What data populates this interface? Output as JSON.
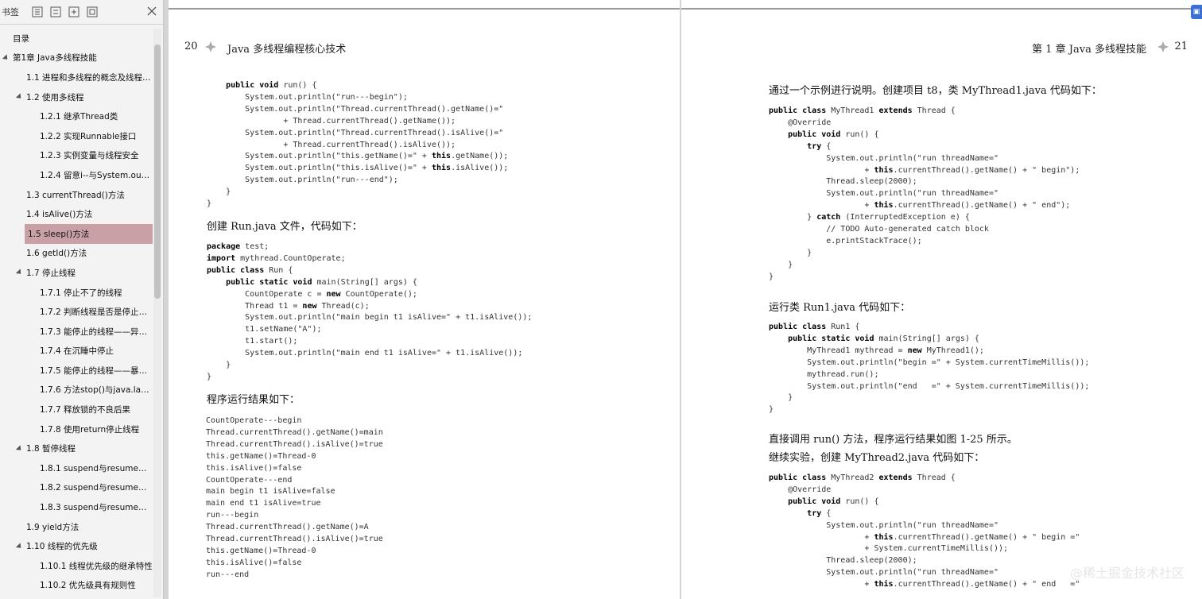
{
  "sidebar": {
    "header_title": "书签",
    "items": [
      {
        "label": "目录",
        "level": 0,
        "expand": false
      },
      {
        "label": "第1章 Java多线程技能",
        "level": 0,
        "expand": true
      },
      {
        "label": "1.1 进程和多线程的概念及线程的...",
        "level": 1,
        "expand": false
      },
      {
        "label": "1.2 使用多线程",
        "level": 1,
        "expand": true
      },
      {
        "label": "1.2.1 继承Thread类",
        "level": 2,
        "expand": false
      },
      {
        "label": "1.2.2 实现Runnable接口",
        "level": 2,
        "expand": false
      },
      {
        "label": "1.2.3 实例变量与线程安全",
        "level": 2,
        "expand": false
      },
      {
        "label": "1.2.4 留意i--与System.out.pr...",
        "level": 2,
        "expand": false
      },
      {
        "label": "1.3 currentThread()方法",
        "level": 1,
        "expand": false
      },
      {
        "label": "1.4 isAlive()方法",
        "level": 1,
        "expand": false
      },
      {
        "label": "1.5 sleep()方法",
        "level": 1,
        "expand": false,
        "active": true
      },
      {
        "label": "1.6 getId()方法",
        "level": 1,
        "expand": false
      },
      {
        "label": "1.7 停止线程",
        "level": 1,
        "expand": true
      },
      {
        "label": "1.7.1 停止不了的线程",
        "level": 2,
        "expand": false
      },
      {
        "label": "1.7.2 判断线程是否是停止状态",
        "level": 2,
        "expand": false
      },
      {
        "label": "1.7.3 能停止的线程——异常法",
        "level": 2,
        "expand": false
      },
      {
        "label": "1.7.4 在沉睡中停止",
        "level": 2,
        "expand": false
      },
      {
        "label": "1.7.5 能停止的线程——暴力...",
        "level": 2,
        "expand": false
      },
      {
        "label": "1.7.6 方法stop()与java.lang....",
        "level": 2,
        "expand": false
      },
      {
        "label": "1.7.7 释放锁的不良后果",
        "level": 2,
        "expand": false
      },
      {
        "label": "1.7.8 使用return停止线程",
        "level": 2,
        "expand": false
      },
      {
        "label": "1.8 暂停线程",
        "level": 1,
        "expand": true
      },
      {
        "label": "1.8.1 suspend与resume方法...",
        "level": 2,
        "expand": false
      },
      {
        "label": "1.8.2 suspend与resume方法...",
        "level": 2,
        "expand": false
      },
      {
        "label": "1.8.3 suspend与resume方法...",
        "level": 2,
        "expand": false
      },
      {
        "label": "1.9 yield方法",
        "level": 1,
        "expand": false
      },
      {
        "label": "1.10 线程的优先级",
        "level": 1,
        "expand": true
      },
      {
        "label": "1.10.1 线程优先级的继承特性",
        "level": 2,
        "expand": false
      },
      {
        "label": "1.10.2 优先级具有规则性",
        "level": 2,
        "expand": false
      }
    ]
  },
  "left_page": {
    "number": "20",
    "title": "Java 多线程编程核心技术",
    "code1": "    <b>public void</b> run() {\n        System.out.println(\"run---begin\");\n        System.out.println(\"Thread.currentThread().getName()=\"\n                + Thread.currentThread().getName());\n        System.out.println(\"Thread.currentThread().isAlive()=\"\n                + Thread.currentThread().isAlive());\n        System.out.println(\"this.getName()=\" + <b>this</b>.getName());\n        System.out.println(\"this.isAlive()=\" + <b>this</b>.isAlive());\n        System.out.println(\"run---end\");\n    }\n}",
    "text1": "创建 Run.java 文件，代码如下：",
    "code2": "<b>package</b> test;\n<b>import</b> mythread.CountOperate;\n<b>public class</b> Run {\n    <b>public static void</b> main(String[] args) {\n        CountOperate c = <b>new</b> CountOperate();\n        Thread t1 = <b>new</b> Thread(c);\n        System.out.println(\"main begin t1 isAlive=\" + t1.isAlive());\n        t1.setName(\"A\");\n        t1.start();\n        System.out.println(\"main end t1 isAlive=\" + t1.isAlive());\n    }\n}",
    "text2": "程序运行结果如下：",
    "code3": "CountOperate---begin\nThread.currentThread().getName()=main\nThread.currentThread().isAlive()=true\nthis.getName()=Thread-0\nthis.isAlive()=false\nCountOperate---end\nmain begin t1 isAlive=false\nmain end t1 isAlive=true\nrun---begin\nThread.currentThread().getName()=A\nThread.currentThread().isAlive()=true\nthis.getName()=Thread-0\nthis.isAlive()=false\nrun---end"
  },
  "right_page": {
    "number": "21",
    "title": "第 1 章   Java 多线程技能",
    "text1": "通过一个示例进行说明。创建项目 t8，类 MyThread1.java 代码如下：",
    "code1": "<b>public class</b> MyThread1 <b>extends</b> Thread {\n    @Override\n    <b>public void</b> run() {\n        <b>try</b> {\n            System.out.println(\"run threadName=\"\n                    + <b>this</b>.currentThread().getName() + \" begin\");\n            Thread.sleep(2000);\n            System.out.println(\"run threadName=\"\n                    + <b>this</b>.currentThread().getName() + \" end\");\n        } <b>catch</b> (InterruptedException e) {\n            // TODO Auto-generated catch block\n            e.printStackTrace();\n        }\n    }\n}",
    "text2": "运行类 Run1.java 代码如下：",
    "code2": "<b>public class</b> Run1 {\n    <b>public static void</b> main(String[] args) {\n        MyThread1 mythread = <b>new</b> MyThread1();\n        System.out.println(\"begin =\" + System.currentTimeMillis());\n        mythread.run();\n        System.out.println(\"end   =\" + System.currentTimeMillis());\n    }\n}",
    "text3": "直接调用 run() 方法，程序运行结果如图 1-25 所示。",
    "text4": "继续实验，创建 MyThread2.java 代码如下：",
    "code3": "<b>public class</b> MyThread2 <b>extends</b> Thread {\n    @Override\n    <b>public void</b> run() {\n        <b>try</b> {\n            System.out.println(\"run threadName=\"\n                    + <b>this</b>.currentThread().getName() + \" begin =\"\n                    + System.currentTimeMillis());\n            Thread.sleep(2000);\n            System.out.println(\"run threadName=\"\n                    + <b>this</b>.currentThread().getName() + \" end   =\""
  },
  "watermark": "@稀土掘金技术社区",
  "badge": "▣"
}
